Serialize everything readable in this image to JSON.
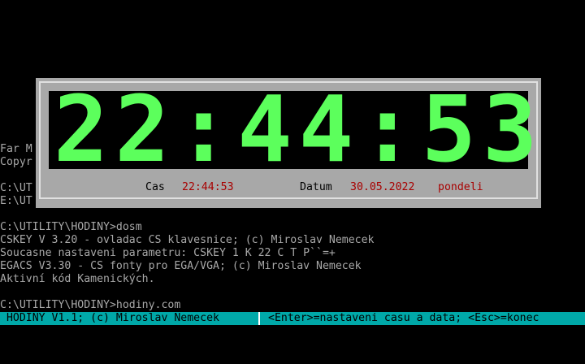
{
  "terminal": {
    "lines": [
      "Far M",
      "Copyr",
      "C:\\UT",
      "E:\\UT",
      "C:\\UTILITY\\HODINY>dosm",
      "CSKEY V 3.20 - ovladac CS klavesnice; (c) Miroslav Nemecek",
      "Soucasne nastaveni parametru: CSKEY 1 K 22 C T P``=+",
      "EGACS V3.30 - CS fonty pro EGA/VGA; (c) Miroslav Nemecek",
      "Aktivní kód Kamenických.",
      "C:\\UTILITY\\HODINY>hodiny.com"
    ]
  },
  "clock": {
    "big_time": "22:44:53",
    "time_label": "Cas",
    "time_value": "22:44:53",
    "date_label": "Datum",
    "date_value": "30.05.2022",
    "day_value": "pondeli",
    "digit_color": "#5cff5c",
    "value_color": "#a80000",
    "window_color": "#a8a8a8"
  },
  "status_bar": {
    "left": " HODINY V1.1; (c) Miroslav Nemecek",
    "right": "<Enter>=nastaveni casu a data; <Esc>=konec",
    "color": "#00a8a8"
  }
}
